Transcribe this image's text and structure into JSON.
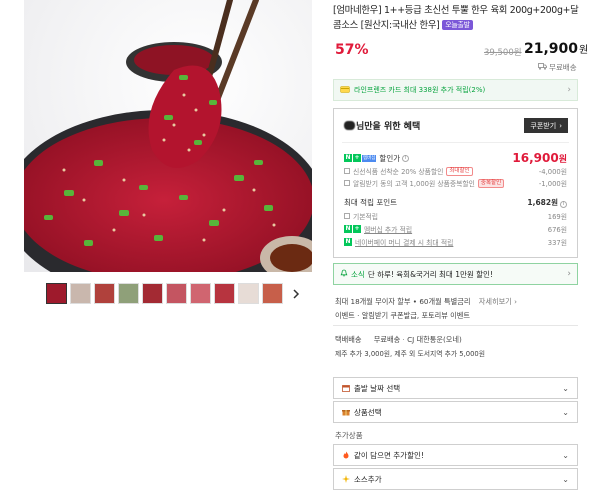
{
  "product": {
    "title": "[엄마네한우] 1++등급 초신선 투뿔 한우 육회 200g+200g+달콤소스 [원산지:국내산 한우]",
    "official_badge": "오늘출발",
    "discount": "57%",
    "original_price": "39,500원",
    "price": "21,900",
    "price_unit": "원",
    "shipping_free": "무료배송"
  },
  "card_banner": {
    "text": "라인프렌즈 카드 최대 338원 추가 적립(2%)"
  },
  "benefit": {
    "title_suffix": "님만을 위한 혜택",
    "coupon_button": "쿠폰받기",
    "discount_label": "할인가",
    "sale_price": "16,900",
    "sale_price_unit": "원",
    "sub1_label": "신선식품 선착순 20% 상품할인",
    "sub1_tag": "최대할인",
    "sub1_value": "-4,000원",
    "sub2_label": "알림받기 동의 고객 1,000원 상품중복할인",
    "sub2_tag": "중복할인",
    "sub2_value": "-1,000원",
    "points_label": "최대 적립 포인트",
    "points_value": "1,682원",
    "basic_label": "기본적립",
    "basic_value": "169원",
    "membership_label": "멤버십 추가 적립",
    "membership_value": "676원",
    "naverpay_label": "네이버페이 머니 결제 시 최대 적립",
    "naverpay_value": "337원"
  },
  "promo_bar": {
    "prefix": "소식",
    "text": "단 하루! 육회&국거리 최대 1만원 할인!"
  },
  "installment": {
    "text": "최대 18개월 무이자 할부 • 60개월 특별금리",
    "link": "자세히보기"
  },
  "event_line": "이벤트 · 알림받기 쿠폰발급, 포토리뷰 이벤트",
  "delivery": {
    "label": "택배배송",
    "fee": "무료배송",
    "carrier": "CJ 대한통운(오네)",
    "extra": "제주 추가 3,000원, 제주 외 도서지역 추가 5,000원"
  },
  "selects": {
    "date": "출발 날짜 선택",
    "option": "상품선택"
  },
  "extra_section_label": "추가상품",
  "extra_selects": {
    "together": "같이 담으면 추가할인!",
    "sauce": "소스추가"
  },
  "colors": {
    "accent_red": "#e01a3a",
    "naver_green": "#03c75a"
  }
}
